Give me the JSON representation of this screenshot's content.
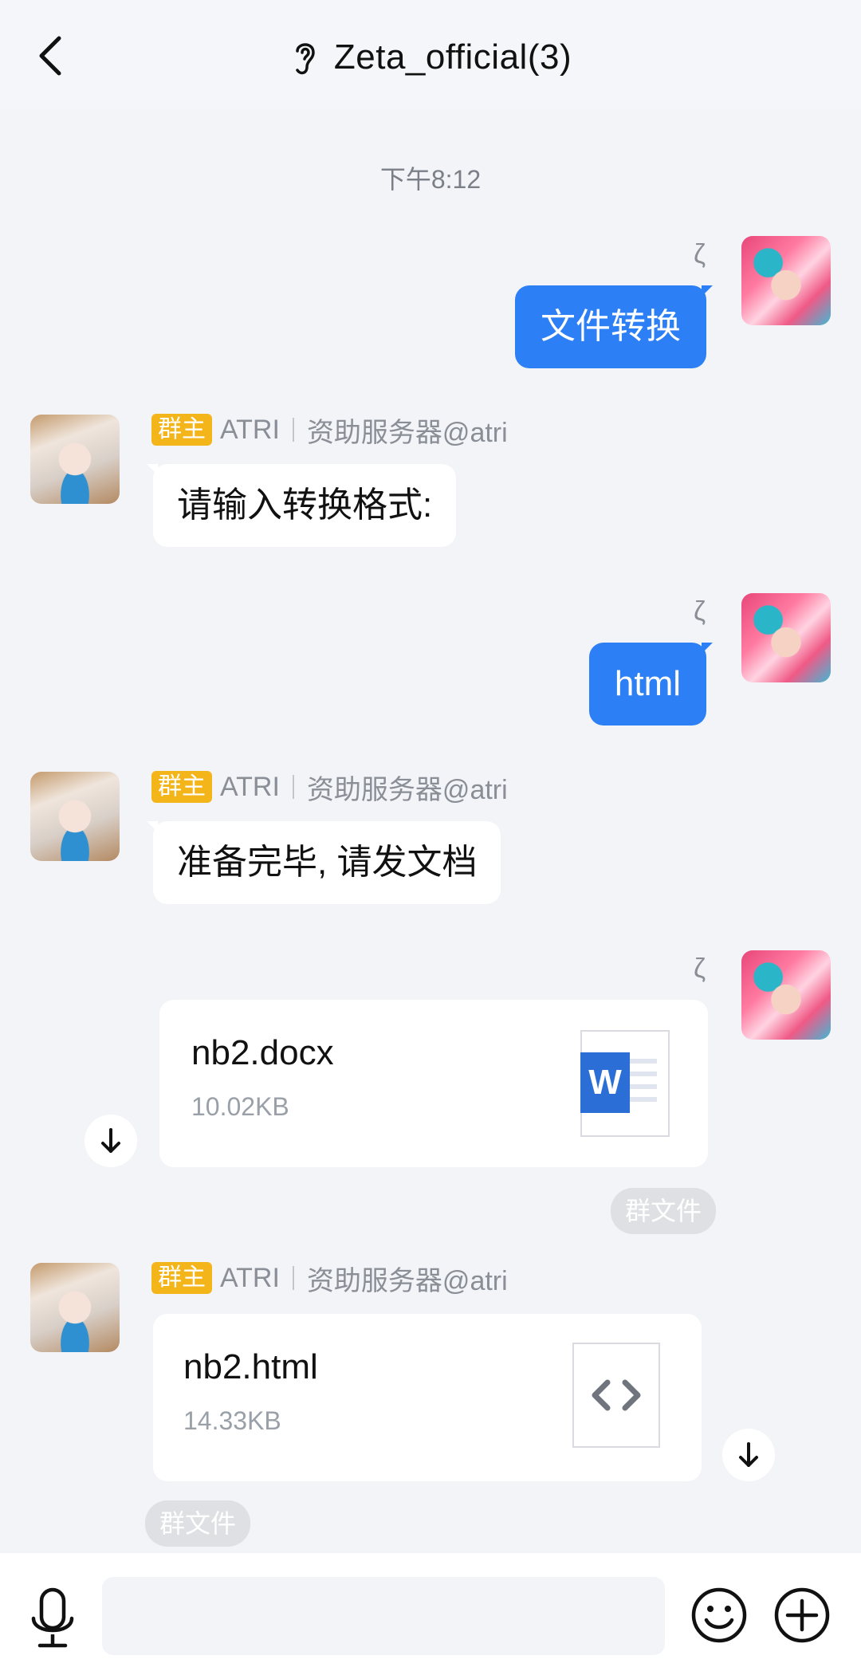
{
  "header": {
    "title": "Zeta_official(3)"
  },
  "timestamp": "下午8:12",
  "me": {
    "name": "ζ"
  },
  "atri": {
    "badge": "群主",
    "name": "ATRI",
    "title": "资助服务器@atri"
  },
  "messages": {
    "m1": "文件转换",
    "m2": "请输入转换格式:",
    "m3": "html",
    "m4": "准备完毕, 请发文档"
  },
  "files": {
    "f1": {
      "name": "nb2.docx",
      "size": "10.02KB",
      "tag": "群文件",
      "icon": "word-icon"
    },
    "f2": {
      "name": "nb2.html",
      "size": "14.33KB",
      "tag": "群文件",
      "icon": "code-icon"
    }
  },
  "colors": {
    "accent": "#2d7ff5",
    "badge": "#f4b51b",
    "word": "#2b6fd6"
  }
}
